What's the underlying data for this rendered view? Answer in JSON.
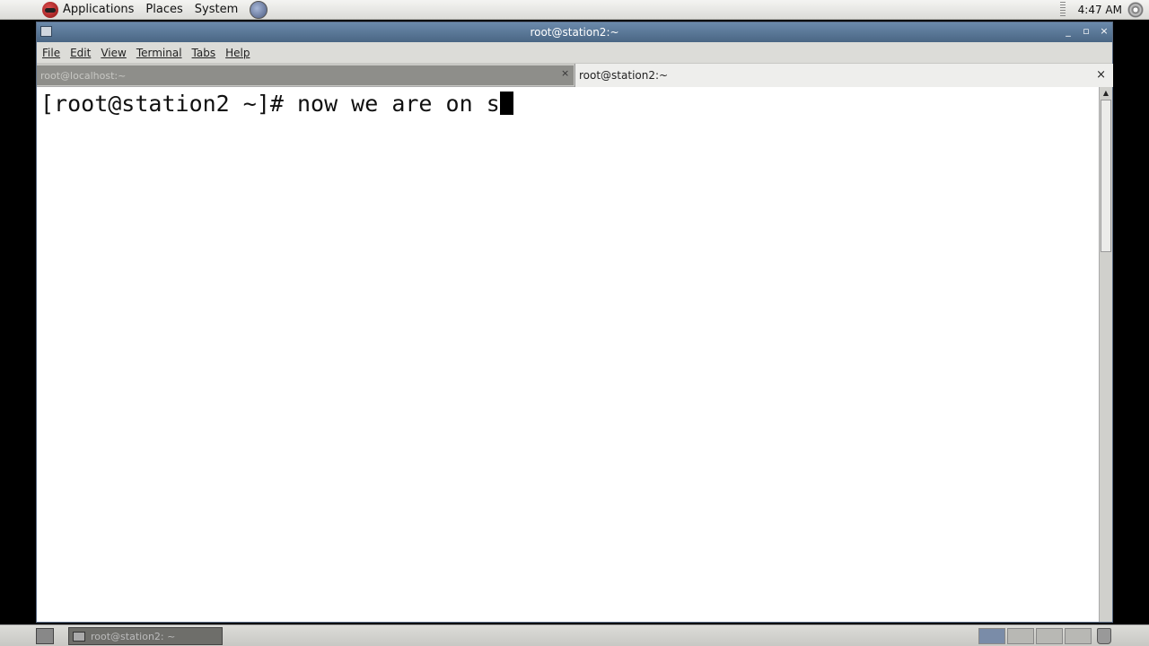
{
  "top_panel": {
    "menus": [
      "Applications",
      "Places",
      "System"
    ],
    "clock": "4:47 AM"
  },
  "window": {
    "title": "root@station2:~",
    "controls": [
      "_",
      "▫",
      "×"
    ]
  },
  "menubar": [
    "File",
    "Edit",
    "View",
    "Terminal",
    "Tabs",
    "Help"
  ],
  "tabs": [
    {
      "label": "root@localhost:~",
      "active": false,
      "close": "×"
    },
    {
      "label": "root@station2:~",
      "active": true,
      "close": "×"
    }
  ],
  "terminal": {
    "line": "[root@station2 ~]# now we are on s"
  },
  "taskbar": {
    "task_label": "root@station2: ~"
  }
}
